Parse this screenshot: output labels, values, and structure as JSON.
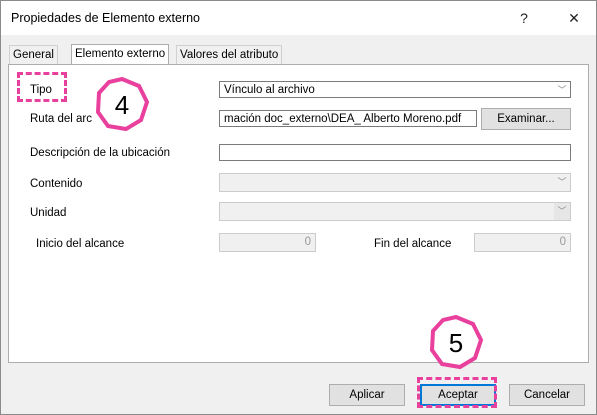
{
  "window": {
    "title": "Propiedades de Elemento externo",
    "help_glyph": "?",
    "close_glyph": "✕"
  },
  "tabs": [
    {
      "label": "General"
    },
    {
      "label": "Elemento externo"
    },
    {
      "label": "Valores del atributo"
    }
  ],
  "form": {
    "tipo_label": "Tipo",
    "tipo_value": "Vínculo al archivo",
    "ruta_label": "Ruta del arc",
    "ruta_value": "mación doc_externo\\DEA_ Alberto Moreno.pdf",
    "examinar_label": "Examinar...",
    "descripcion_label": "Descripción de la ubicación",
    "descripcion_value": "",
    "contenido_label": "Contenido",
    "unidad_label": "Unidad",
    "inicio_label": "Inicio del alcance",
    "inicio_value": "0",
    "fin_label": "Fin del alcance",
    "fin_value": "0"
  },
  "buttons": {
    "aplicar": "Aplicar",
    "aceptar": "Aceptar",
    "cancelar": "Cancelar"
  },
  "annotations": {
    "step4": "4",
    "step5": "5",
    "color": "#e8409c"
  }
}
